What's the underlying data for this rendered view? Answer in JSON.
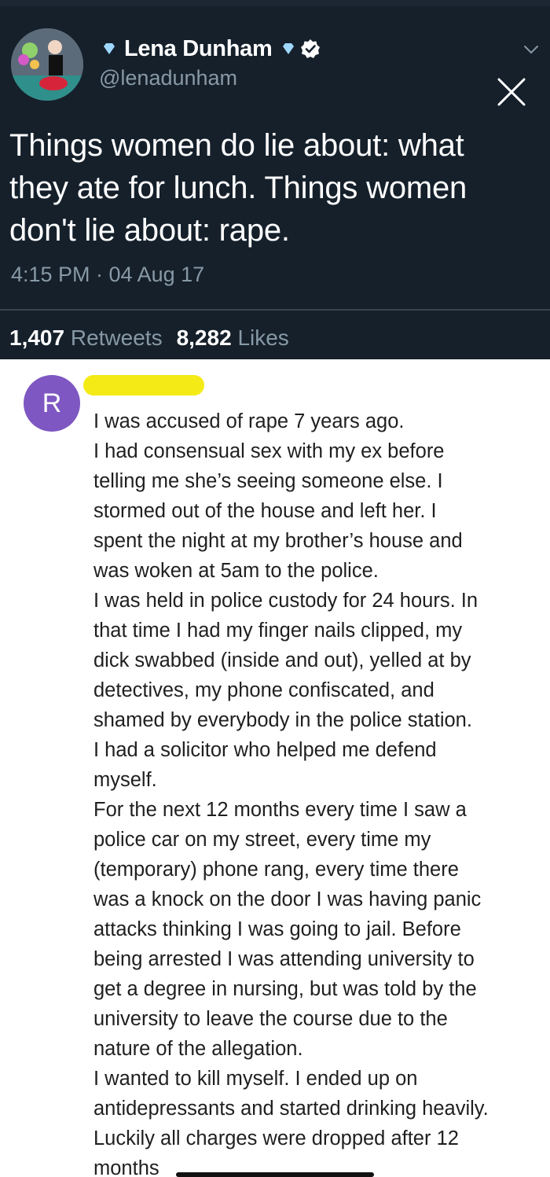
{
  "tweet": {
    "display_name": "Lena Dunham",
    "handle": "@lenadunham",
    "text": "Things women do lie about: what they ate for lunch. Things women don't lie about: rape.",
    "text_lines": [
      "Things women do lie about: what",
      "they ate for lunch. Things women",
      "don't lie about: rape."
    ],
    "timestamp": "4:15 PM · 04 Aug 17",
    "retweets_count": "1,407",
    "retweets_label": "Retweets",
    "likes_count": "8,282",
    "likes_label": "Likes"
  },
  "reply": {
    "avatar_letter": "R",
    "lines": [
      "I was accused of rape 7 years ago.",
      "I had consensual sex with my ex before",
      "telling me she’s seeing someone else. I",
      "stormed out of the house and left her. I",
      "spent the night at my brother’s house and",
      "was woken at 5am to the police.",
      "I was held in police custody for 24 hours. In",
      "that time I had my finger nails clipped, my",
      "dick swabbed (inside and out), yelled at by",
      "detectives, my phone confiscated, and",
      "shamed by everybody in the police station.",
      "I had a solicitor who helped me defend",
      "myself.",
      "For the next 12 months every time I saw a",
      "police car on my street, every time my",
      "(temporary) phone rang, every time there",
      "was a knock on the door I was having panic",
      "attacks thinking I was going to jail. Before",
      "being arrested I was attending university to",
      "get a degree in nursing, but was told by the",
      "university to leave the course due to the",
      "nature of the allegation.",
      "I wanted to kill myself. I ended up on",
      "antidepressants and started drinking heavily.",
      "Luckily all charges were dropped after 12",
      "months"
    ]
  },
  "colors": {
    "tweet_bg": "#15202b",
    "muted_text": "#8899a6",
    "avatar_purple": "#7e57c2",
    "redaction_yellow": "#f4ea16"
  },
  "icons": {
    "verified": "verified-badge-icon",
    "close": "close-icon",
    "chevron": "chevron-down-icon",
    "diamond": "diamond-emoji-icon"
  }
}
